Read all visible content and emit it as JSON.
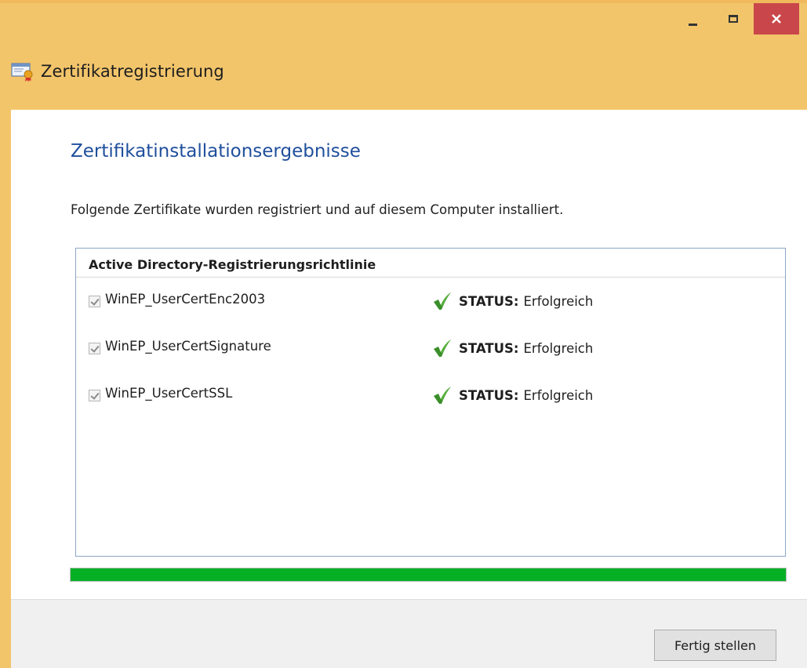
{
  "window": {
    "title": "Zertifikatregistrierung",
    "controls": {
      "minimize": "minimize-icon",
      "maximize": "maximize-icon",
      "close": "close-icon"
    },
    "accent_color": "#f3c56b"
  },
  "page": {
    "heading": "Zertifikatinstallationsergebnisse",
    "intro": "Folgende Zertifikate wurden registriert und auf diesem Computer installiert."
  },
  "results": {
    "group_title": "Active Directory-Registrierungsrichtlinie",
    "items": [
      {
        "name": "WinEP_UserCertEnc2003",
        "checked": true,
        "status_label": "STATUS:",
        "status_value": "Erfolgreich"
      },
      {
        "name": "WinEP_UserCertSignature",
        "checked": true,
        "status_label": "STATUS:",
        "status_value": "Erfolgreich"
      },
      {
        "name": "WinEP_UserCertSSL",
        "checked": true,
        "status_label": "STATUS:",
        "status_value": "Erfolgreich"
      }
    ],
    "status_icon": "green-checkmark-icon",
    "status_color": "#3a8f2a"
  },
  "progress": {
    "value_percent": 100,
    "color": "#06b025"
  },
  "footer": {
    "finish_label": "Fertig stellen"
  }
}
